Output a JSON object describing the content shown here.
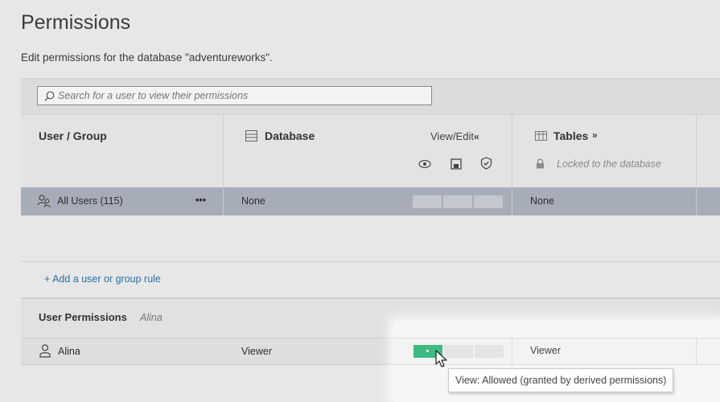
{
  "page": {
    "title": "Permissions",
    "subtitle": "Edit permissions for the database \"adventureworks\"."
  },
  "search": {
    "placeholder": "Search for a user to view their permissions"
  },
  "columns": {
    "user_group": "User / Group",
    "database": {
      "label": "Database",
      "mode": "View/Edit",
      "collapse_glyph": "«"
    },
    "tables": {
      "label": "Tables",
      "expand_glyph": "»",
      "locked_text": "Locked to the database"
    }
  },
  "capability_icons": [
    "eye-icon",
    "save-icon",
    "shield-check-icon"
  ],
  "rules": [
    {
      "name": "All Users (115)",
      "more": "•••",
      "database_template": "None",
      "tables_template": "None"
    }
  ],
  "add_rule_label": "+ Add a user or group rule",
  "user_permissions": {
    "label": "User Permissions",
    "user": "Alina",
    "row": {
      "name": "Alina",
      "database_role": "Viewer",
      "tables_role": "Viewer"
    }
  },
  "capability_state": {
    "view": "allowed",
    "save": "unspecified",
    "certify": "unspecified"
  },
  "tooltip": "View: Allowed (granted by derived permissions)",
  "colors": {
    "allowed": "#3dbb83",
    "selected_row": "#a6adb9",
    "link": "#2c6fa6"
  }
}
